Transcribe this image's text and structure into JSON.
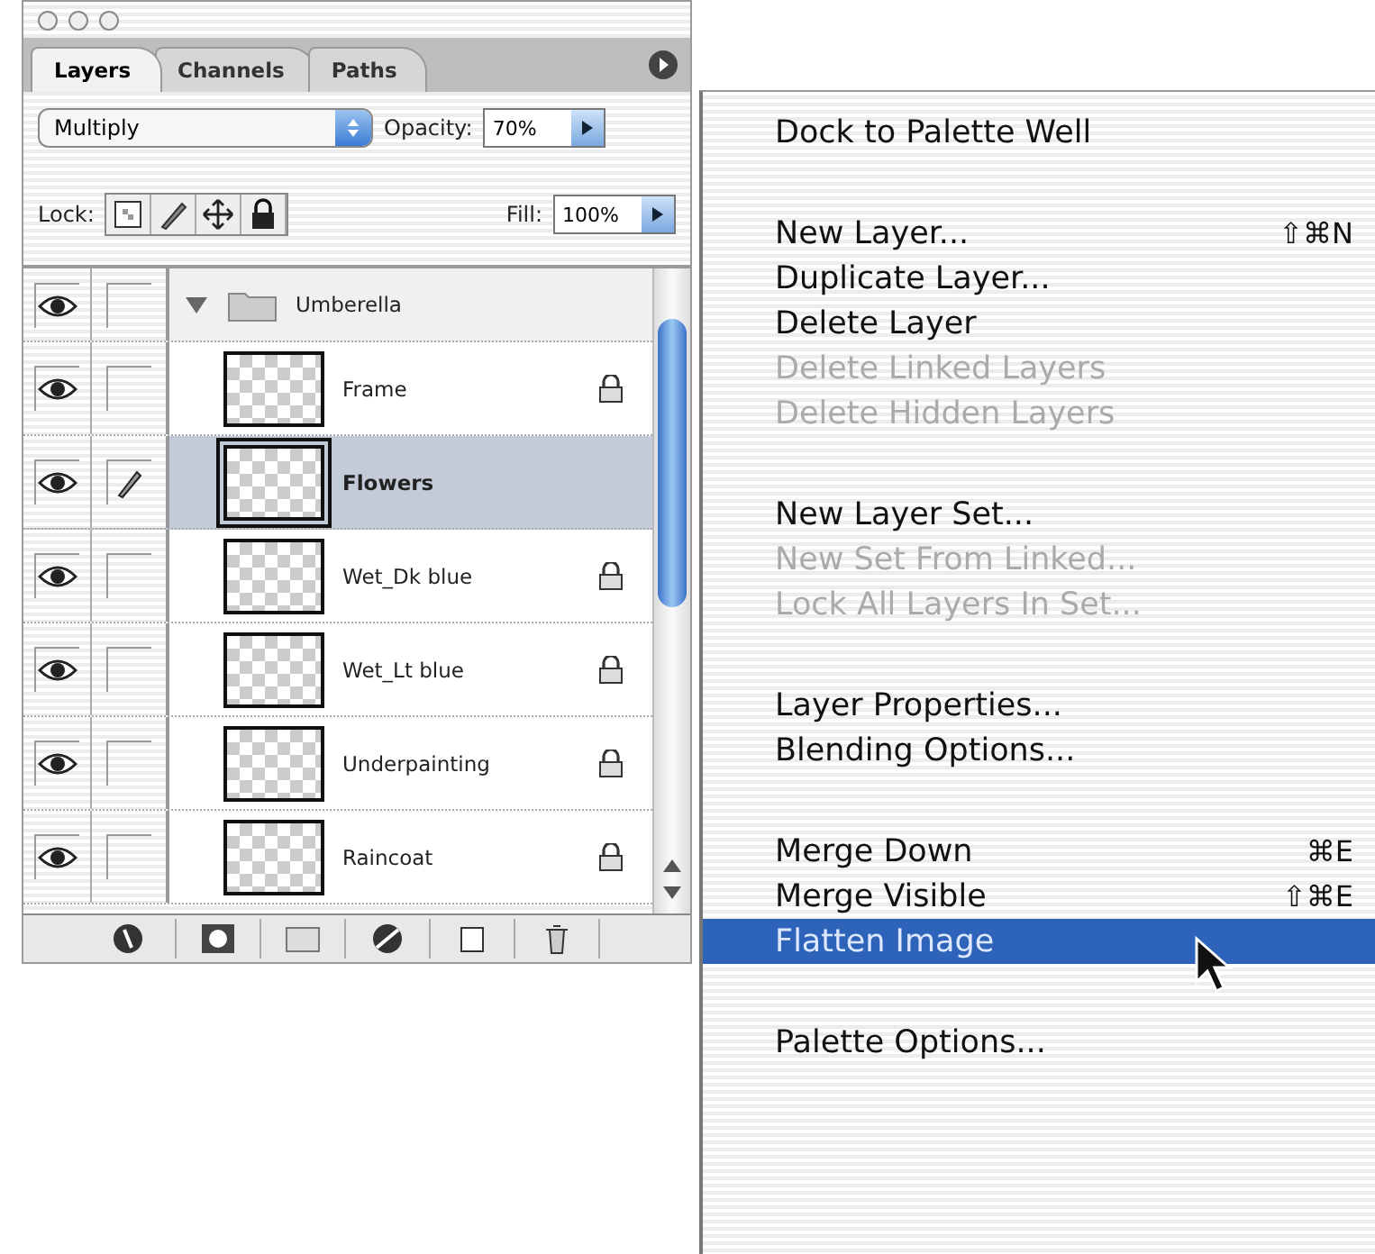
{
  "palette": {
    "tabs": [
      {
        "label": "Layers",
        "selected": true
      },
      {
        "label": "Channels",
        "selected": false
      },
      {
        "label": "Paths",
        "selected": false
      }
    ],
    "blend_mode": "Multiply",
    "opacity_label": "Opacity:",
    "opacity": "70%",
    "lock_label": "Lock:",
    "fill_label": "Fill:",
    "fill": "100%",
    "layers": [
      {
        "kind": "set",
        "name": "Umberella",
        "expanded": true,
        "visible": true,
        "brush": false,
        "selected": false
      },
      {
        "kind": "layer",
        "name": "Frame",
        "visible": true,
        "brush": false,
        "selected": false,
        "locked": true
      },
      {
        "kind": "layer",
        "name": "Flowers",
        "visible": true,
        "brush": true,
        "selected": true,
        "locked": false
      },
      {
        "kind": "layer",
        "name": "Wet_Dk blue",
        "visible": true,
        "brush": false,
        "selected": false,
        "locked": true
      },
      {
        "kind": "layer",
        "name": "Wet_Lt blue",
        "visible": true,
        "brush": false,
        "selected": false,
        "locked": true
      },
      {
        "kind": "layer",
        "name": "Underpainting",
        "visible": true,
        "brush": false,
        "selected": false,
        "locked": true
      },
      {
        "kind": "layer",
        "name": "Raincoat",
        "visible": true,
        "brush": false,
        "selected": false,
        "locked": true
      }
    ]
  },
  "menu": {
    "groups": [
      [
        {
          "label": "Dock to Palette Well",
          "disabled": false,
          "selected": false
        }
      ],
      [
        {
          "label": "New Layer...",
          "shortcut": "⇧⌘N",
          "disabled": false,
          "selected": false
        },
        {
          "label": "Duplicate Layer...",
          "disabled": false,
          "selected": false
        },
        {
          "label": "Delete Layer",
          "disabled": false,
          "selected": false
        },
        {
          "label": "Delete Linked Layers",
          "disabled": true,
          "selected": false
        },
        {
          "label": "Delete Hidden Layers",
          "disabled": true,
          "selected": false
        }
      ],
      [
        {
          "label": "New Layer Set...",
          "disabled": false,
          "selected": false
        },
        {
          "label": "New Set From Linked...",
          "disabled": true,
          "selected": false
        },
        {
          "label": "Lock All Layers In Set...",
          "disabled": true,
          "selected": false
        }
      ],
      [
        {
          "label": "Layer Properties...",
          "disabled": false,
          "selected": false
        },
        {
          "label": "Blending Options...",
          "disabled": false,
          "selected": false
        }
      ],
      [
        {
          "label": "Merge Down",
          "shortcut": "⌘E",
          "disabled": false,
          "selected": false
        },
        {
          "label": "Merge Visible",
          "shortcut": "⇧⌘E",
          "disabled": false,
          "selected": false
        },
        {
          "label": "Flatten Image",
          "disabled": false,
          "selected": true
        }
      ],
      [
        {
          "label": "Palette Options...",
          "disabled": false,
          "selected": false
        }
      ]
    ]
  }
}
